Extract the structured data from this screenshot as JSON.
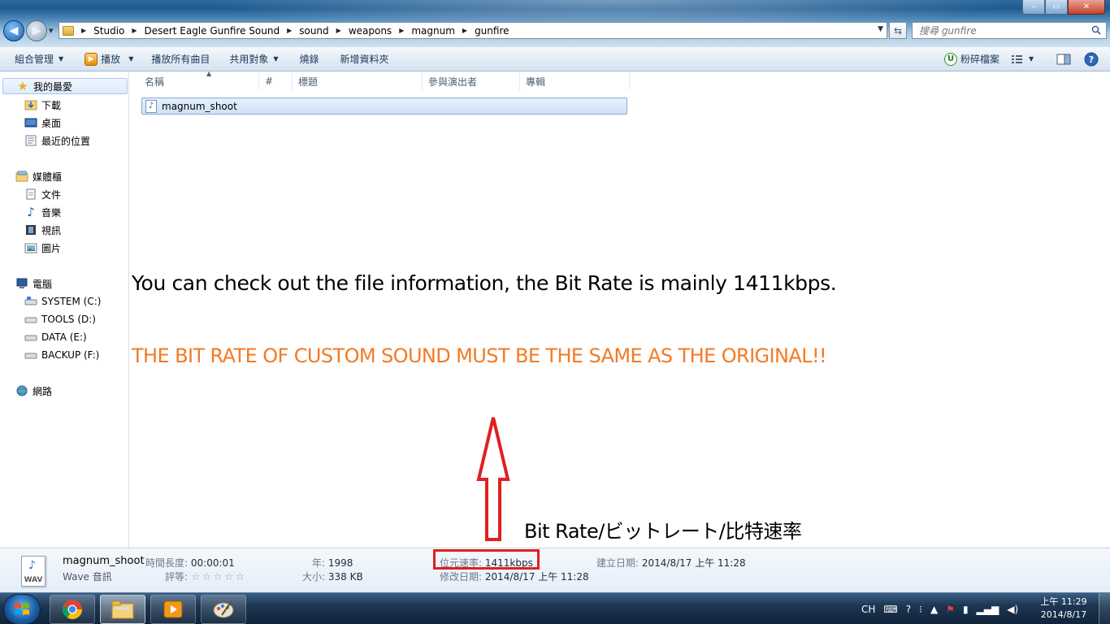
{
  "window": {
    "minimize_glyph": "–",
    "maximize_glyph": "▭",
    "close_glyph": "✕"
  },
  "address": {
    "breadcrumbs": [
      "Studio",
      "Desert Eagle Gunfire Sound",
      "sound",
      "weapons",
      "magnum",
      "gunfire"
    ],
    "search_placeholder": "搜尋 gunfire"
  },
  "commandbar": {
    "organize": "組合管理",
    "play": "播放",
    "play_all": "播放所有曲目",
    "share_with": "共用對象",
    "burn": "燒錄",
    "new_folder": "新增資料夾",
    "shred": "粉碎檔案"
  },
  "nav": {
    "favorites": "我的最愛",
    "downloads": "下載",
    "desktop": "桌面",
    "recent": "最近的位置",
    "libraries": "媒體櫃",
    "documents": "文件",
    "music": "音樂",
    "videos": "視訊",
    "pictures": "圖片",
    "computer": "電腦",
    "drive_c": "SYSTEM (C:)",
    "drive_d": "TOOLS (D:)",
    "drive_e": "DATA (E:)",
    "drive_f": "BACKUP (F:)",
    "network": "網路"
  },
  "columns": {
    "name": "名稱",
    "number": "#",
    "title": "標題",
    "contributing_artists": "參與演出者",
    "album": "專輯"
  },
  "files": [
    {
      "name": "magnum_shoot"
    }
  ],
  "annotations": {
    "line1": "You can check out the file information, the Bit Rate is mainly 1411kbps.",
    "line2": "THE BIT RATE OF CUSTOM SOUND MUST BE THE SAME AS THE ORIGINAL!!",
    "bitrate_label": "Bit Rate/ビットレート/比特速率",
    "line2_color": "#f37a23",
    "highlight_color": "#e0201f"
  },
  "details": {
    "file_name": "magnum_shoot",
    "file_type": "Wave 音訊",
    "icon_label": "WAV",
    "length_key": "時間長度:",
    "length_val": "00:00:01",
    "rating_key": "評等:",
    "rating_stars": 0,
    "year_key": "年:",
    "year_val": "1998",
    "size_key": "大小:",
    "size_val": "338 KB",
    "bitrate_key": "位元速率:",
    "bitrate_val": "1411kbps",
    "modified_key": "修改日期:",
    "modified_val": "2014/8/17 上午 11:28",
    "created_key": "建立日期:",
    "created_val": "2014/8/17 上午 11:28"
  },
  "taskbar": {
    "language": "CH",
    "time": "上午 11:29",
    "date": "2014/8/17"
  }
}
